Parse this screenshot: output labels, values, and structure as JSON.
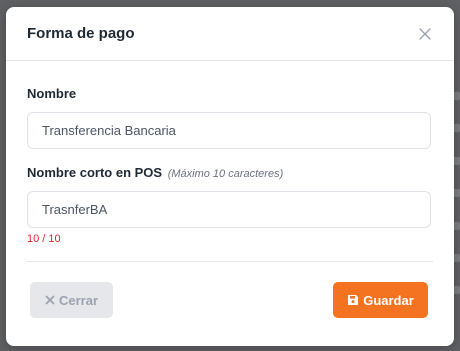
{
  "modal": {
    "title": "Forma de pago",
    "close_icon": "close-icon"
  },
  "form": {
    "name_label": "Nombre",
    "name_value": "Transferencia Bancaria",
    "short_name_label": "Nombre corto en POS",
    "short_name_hint": "(Máximo 10 caracteres)",
    "short_name_value": "TrasnferBA",
    "char_counter": "10 / 10"
  },
  "footer": {
    "cancel_label": "Cerrar",
    "cancel_icon": "x-icon",
    "save_label": "Guardar",
    "save_icon": "floppy-disk-icon"
  },
  "colors": {
    "primary": "#f37320",
    "counter_error": "#dc2626",
    "cancel_bg": "#e5e7eb"
  }
}
